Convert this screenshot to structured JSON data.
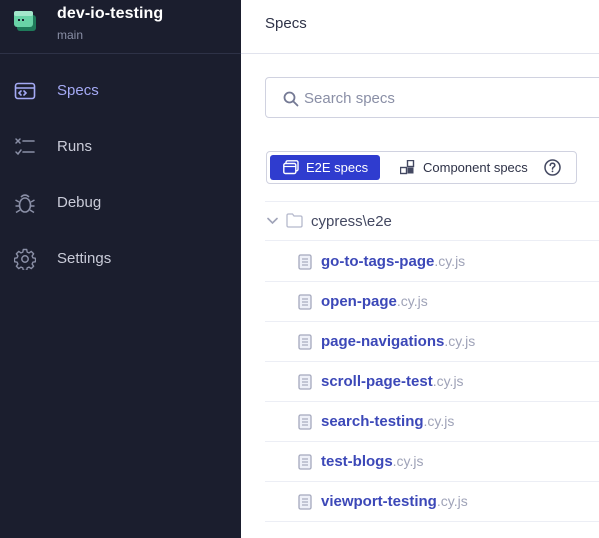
{
  "project": {
    "name": "dev-io-testing",
    "branch": "main"
  },
  "nav": [
    {
      "label": "Specs",
      "icon": "specs-icon",
      "active": true
    },
    {
      "label": "Runs",
      "icon": "runs-icon",
      "active": false
    },
    {
      "label": "Debug",
      "icon": "debug-icon",
      "active": false
    },
    {
      "label": "Settings",
      "icon": "settings-icon",
      "active": false
    }
  ],
  "header": {
    "title": "Specs"
  },
  "search": {
    "placeholder": "Search specs",
    "value": ""
  },
  "tabs": {
    "e2e_label": "E2E specs",
    "component_label": "Component specs"
  },
  "folder": {
    "label": "cypress\\e2e"
  },
  "specs": [
    {
      "name": "go-to-tags-page",
      "ext": ".cy.js"
    },
    {
      "name": "open-page",
      "ext": ".cy.js"
    },
    {
      "name": "page-navigations",
      "ext": ".cy.js"
    },
    {
      "name": "scroll-page-test",
      "ext": ".cy.js"
    },
    {
      "name": "search-testing",
      "ext": ".cy.js"
    },
    {
      "name": "test-blogs",
      "ext": ".cy.js"
    },
    {
      "name": "viewport-testing",
      "ext": ".cy.js"
    }
  ],
  "colors": {
    "sidebar_bg": "#1b1e2e",
    "active_nav": "#a5aaf5",
    "accent": "#2f3ccf",
    "spec_link": "#3c48b8",
    "logo_green": "#69d3a7"
  }
}
